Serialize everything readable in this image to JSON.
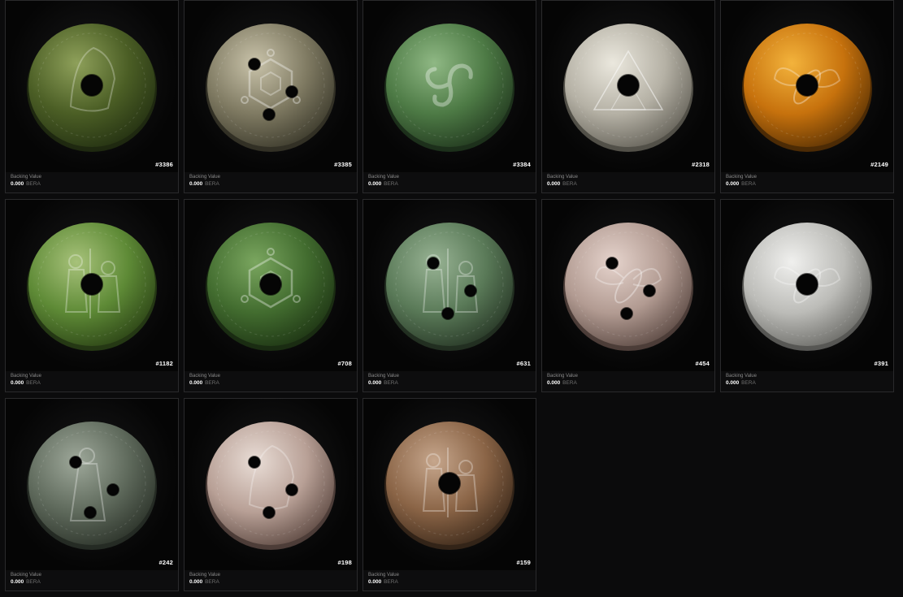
{
  "label": "Backing Value",
  "cards": [
    {
      "id": "#3386",
      "value": "0.000",
      "currency": "BERA",
      "coin": {
        "c1": "#8ea05a",
        "c2": "#4b5e25",
        "c3": "#243112"
      },
      "motif": "hood-icon",
      "holes": 1
    },
    {
      "id": "#3385",
      "value": "0.000",
      "currency": "BERA",
      "coin": {
        "c1": "#c9c3aa",
        "c2": "#7f7a62",
        "c3": "#3c3a2c"
      },
      "motif": "hexagon-network-icon",
      "holes": 3
    },
    {
      "id": "#3384",
      "value": "0.000",
      "currency": "BERA",
      "coin": {
        "c1": "#8fb884",
        "c2": "#4d7a45",
        "c3": "#22391f"
      },
      "motif": "triskelion-icon",
      "holes": 0
    },
    {
      "id": "#2318",
      "value": "0.000",
      "currency": "BERA",
      "coin": {
        "c1": "#ebe8de",
        "c2": "#b5b1a5",
        "c3": "#646158"
      },
      "motif": "triangle-icon",
      "holes": 1
    },
    {
      "id": "#2149",
      "value": "0.000",
      "currency": "BERA",
      "coin": {
        "c1": "#f3b33c",
        "c2": "#c7720d",
        "c3": "#5c3304"
      },
      "motif": "bee-icon",
      "holes": 1
    },
    {
      "id": "#1182",
      "value": "0.000",
      "currency": "BERA",
      "coin": {
        "c1": "#a7c27a",
        "c2": "#5e8a36",
        "c3": "#2c4416"
      },
      "motif": "figures-icon",
      "holes": 1
    },
    {
      "id": "#708",
      "value": "0.000",
      "currency": "BERA",
      "coin": {
        "c1": "#7aa65f",
        "c2": "#426c2f",
        "c3": "#1e3514"
      },
      "motif": "hexagon-network-icon",
      "holes": 1
    },
    {
      "id": "#631",
      "value": "0.000",
      "currency": "BERA",
      "coin": {
        "c1": "#98b394",
        "c2": "#5a7a58",
        "c3": "#283827"
      },
      "motif": "figures-icon",
      "holes": 3
    },
    {
      "id": "#454",
      "value": "0.000",
      "currency": "BERA",
      "coin": {
        "c1": "#e5d3cc",
        "c2": "#b29b92",
        "c3": "#5c4a44"
      },
      "motif": "bee-icon",
      "holes": 3
    },
    {
      "id": "#391",
      "value": "0.000",
      "currency": "BERA",
      "coin": {
        "c1": "#f0f0ee",
        "c2": "#bcbcb8",
        "c3": "#6a6a66"
      },
      "motif": "bee-icon",
      "holes": 1
    },
    {
      "id": "#242",
      "value": "0.000",
      "currency": "BERA",
      "coin": {
        "c1": "#9ea89a",
        "c2": "#5f6a5c",
        "c3": "#2c332a"
      },
      "motif": "robed-figure-icon",
      "holes": 3
    },
    {
      "id": "#198",
      "value": "0.000",
      "currency": "BERA",
      "coin": {
        "c1": "#e9ddd6",
        "c2": "#b8a096",
        "c3": "#5e4a43"
      },
      "motif": "hood-icon",
      "holes": 3
    },
    {
      "id": "#159",
      "value": "0.000",
      "currency": "BERA",
      "coin": {
        "c1": "#c6a68c",
        "c2": "#8a6446",
        "c3": "#3d2a1b"
      },
      "motif": "figures-icon",
      "holes": 1
    }
  ]
}
